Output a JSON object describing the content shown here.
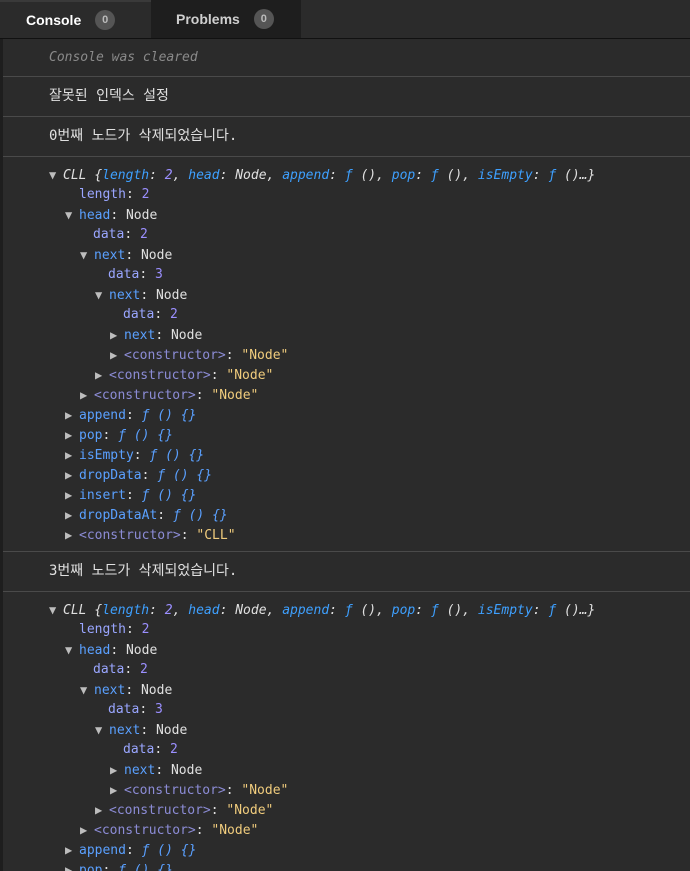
{
  "tabs": [
    {
      "label": "Console",
      "count": "0"
    },
    {
      "label": "Problems",
      "count": "0"
    }
  ],
  "console": {
    "cleared": "Console was cleared",
    "msg1": "잘못된 인덱스 설정",
    "msg2": "0번째 노드가 삭제되었습니다.",
    "msg3": "3번째 노드가 삭제되었습니다.",
    "summary": {
      "cls": "CLL",
      "open": "{",
      "k_length": "length",
      "v_length": "2",
      "k_head": "head",
      "v_head": "Node",
      "k_append": "append",
      "k_pop": "pop",
      "k_isEmpty": "isEmpty",
      "f": "ƒ",
      "paren": "()",
      "ellipsis": "()…}"
    },
    "tree": {
      "length": "length",
      "length_val": "2",
      "head": "head",
      "node": "Node",
      "data": "data",
      "next": "next",
      "constructor": "<constructor>",
      "node_str": "\"Node\"",
      "cll_str": "\"CLL\"",
      "d1": "2",
      "d2": "3",
      "d3": "2",
      "fn_body": "ƒ () {}",
      "methods": [
        "append",
        "pop",
        "isEmpty",
        "dropData",
        "insert",
        "dropDataAt"
      ]
    }
  }
}
